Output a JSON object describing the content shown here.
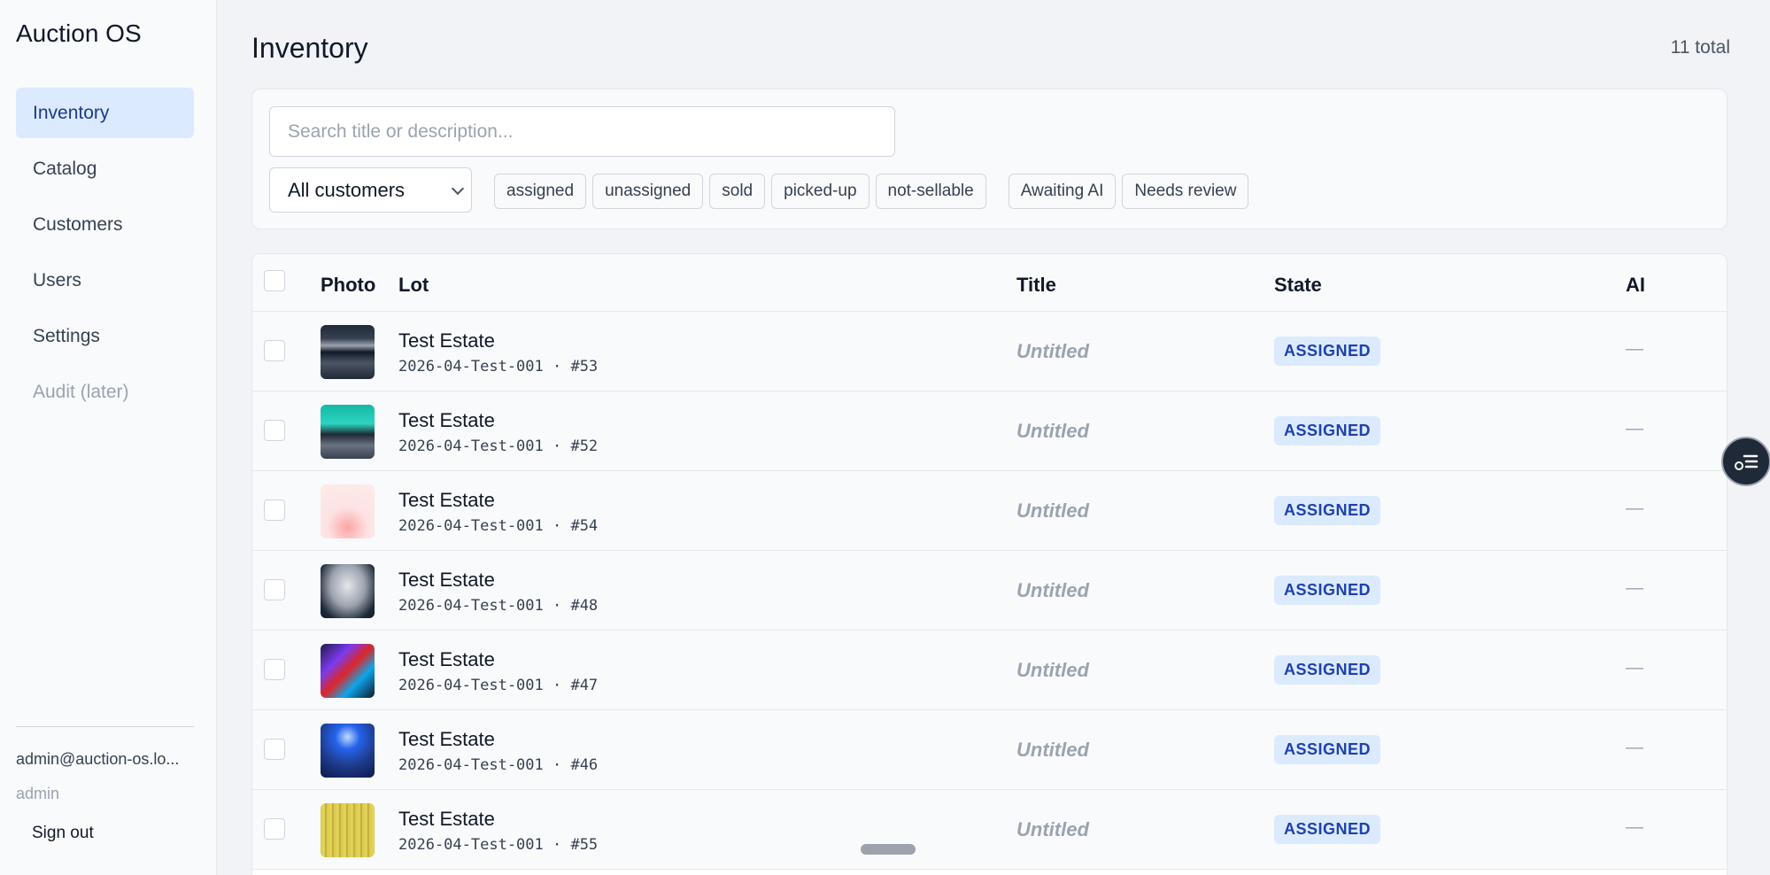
{
  "app": {
    "title": "Auction OS"
  },
  "sidebar": {
    "items": [
      {
        "label": "Inventory"
      },
      {
        "label": "Catalog"
      },
      {
        "label": "Customers"
      },
      {
        "label": "Users"
      },
      {
        "label": "Settings"
      },
      {
        "label": "Audit (later)"
      }
    ],
    "user_email": "admin@auction-os.lo...",
    "user_role": "admin",
    "signout_label": "Sign out"
  },
  "page": {
    "title": "Inventory",
    "total": "11 total"
  },
  "filters": {
    "search_placeholder": "Search title or description...",
    "customer_select": "All customers",
    "state_chips": [
      "assigned",
      "unassigned",
      "sold",
      "picked-up",
      "not-sellable"
    ],
    "review_chips": [
      "Awaiting AI",
      "Needs review"
    ]
  },
  "table": {
    "headers": {
      "photo": "Photo",
      "lot": "Lot",
      "title": "Title",
      "state": "State",
      "ai": "AI"
    },
    "rows": [
      {
        "name": "Test Estate",
        "code": "2026-04-Test-001 · #53",
        "title": "Untitled",
        "state": "ASSIGNED",
        "ai": "—"
      },
      {
        "name": "Test Estate",
        "code": "2026-04-Test-001 · #52",
        "title": "Untitled",
        "state": "ASSIGNED",
        "ai": "—"
      },
      {
        "name": "Test Estate",
        "code": "2026-04-Test-001 · #54",
        "title": "Untitled",
        "state": "ASSIGNED",
        "ai": "—"
      },
      {
        "name": "Test Estate",
        "code": "2026-04-Test-001 · #48",
        "title": "Untitled",
        "state": "ASSIGNED",
        "ai": "—"
      },
      {
        "name": "Test Estate",
        "code": "2026-04-Test-001 · #47",
        "title": "Untitled",
        "state": "ASSIGNED",
        "ai": "—"
      },
      {
        "name": "Test Estate",
        "code": "2026-04-Test-001 · #46",
        "title": "Untitled",
        "state": "ASSIGNED",
        "ai": "—"
      },
      {
        "name": "Test Estate",
        "code": "2026-04-Test-001 · #55",
        "title": "Untitled",
        "state": "ASSIGNED",
        "ai": "—"
      }
    ]
  },
  "colors": {
    "accent": "#dbeafe",
    "accent_text": "#1e3a8a",
    "badge_text": "#1e40af"
  }
}
